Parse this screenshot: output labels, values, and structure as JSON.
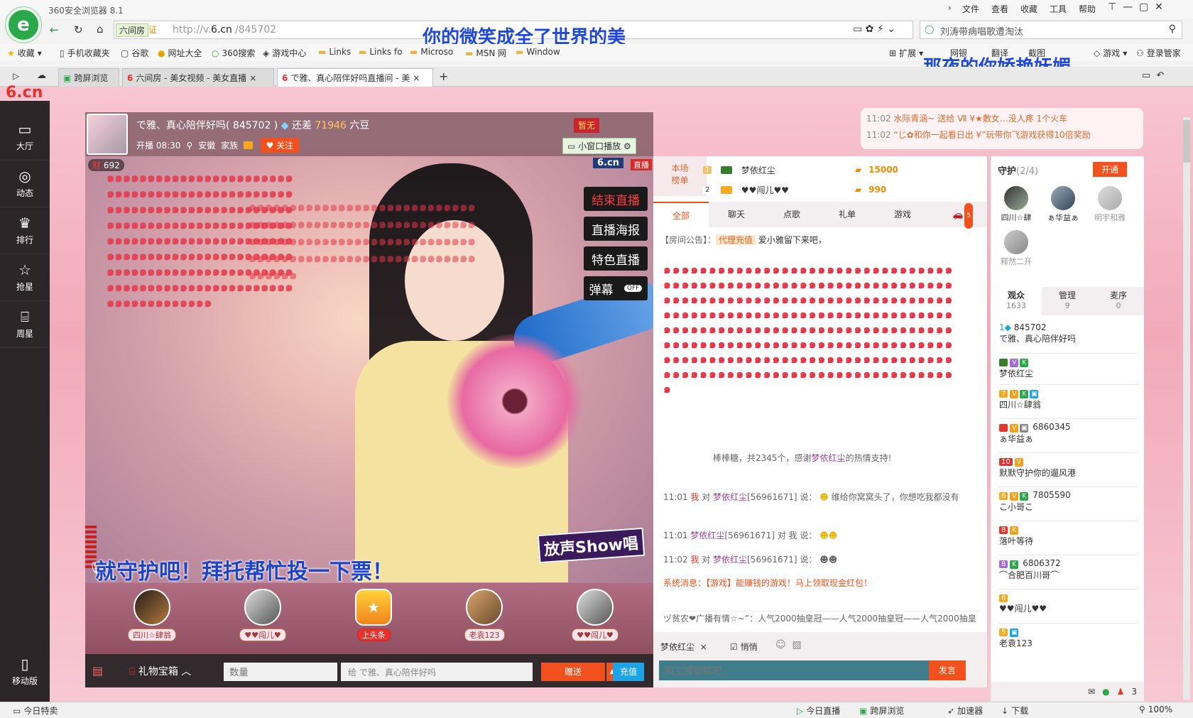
{
  "browser": {
    "app_title": "360安全浏览器 8.1",
    "menu": [
      "文件",
      "查看",
      "收藏",
      "工具",
      "帮助"
    ],
    "address_tag": "六间房",
    "address_cert": "证",
    "url_prefix": "http://v.",
    "url_host": "6.cn",
    "url_path": "/845702",
    "search_text": "刘涛带病唱歌遭淘汰",
    "overlay_top": "你的微笑成全了世界的美",
    "overlay_right": "那夜的你娇艳妩媚",
    "bookmarks": [
      "收藏",
      "手机收藏夹",
      "谷歌",
      "网址大全",
      "360搜索",
      "游戏中心",
      "Links",
      "Links fo",
      "Microso",
      "MSN 网",
      "Window"
    ],
    "tools_right": [
      "扩展",
      "网银",
      "翻译",
      "截图",
      "游戏",
      "登录管家"
    ],
    "tabs": [
      {
        "label": "跨屏浏览"
      },
      {
        "label": "六间房 - 美女视频 - 美女直播"
      },
      {
        "label": "で雅、真心陪伴好吗直播间 - 美"
      }
    ],
    "statusbar": [
      "今日特卖",
      "今日直播",
      "跨屏浏览",
      "加速器",
      "下载",
      "100%"
    ]
  },
  "sidenav": [
    {
      "label": "大厅",
      "icon": "tv-icon"
    },
    {
      "label": "动态",
      "icon": "compass-icon"
    },
    {
      "label": "排行",
      "icon": "crown-icon"
    },
    {
      "label": "抢星",
      "icon": "star-icon"
    },
    {
      "label": "周星",
      "icon": "gift-icon"
    }
  ],
  "mobile_label": "移动版",
  "host": {
    "title": "で雅、真心陪伴好吗",
    "room_id": "( 845702 )",
    "need_text": "还差",
    "need_num": "71946",
    "need_unit": "六豆",
    "start": "开播 08:30",
    "location": "安徽",
    "family": "家族",
    "follow": "关注",
    "mini": "小窗口播放",
    "cash": "692",
    "logo": "6.cn",
    "live": "直播",
    "crown_tag": "暂无"
  },
  "video_buttons": [
    "结束直播",
    "直播海报",
    "特色直播"
  ],
  "danmaku": "弹幕",
  "danmaku_state": "OFF",
  "video_caption": "就守护吧！拜托帮忙投一下票！",
  "brand_show": "放声Show唱",
  "guards_bottom": [
    {
      "name": "四川☆肆翁"
    },
    {
      "name": "♥♥闯儿♥"
    },
    {
      "name": "上头条"
    },
    {
      "name": "老袁123"
    },
    {
      "name": "♥♥闯儿♥"
    }
  ],
  "giftbar": {
    "gift_box": "礼物宝箱",
    "qty_placeholder": "数量",
    "to_label": "给",
    "to_name": "で雅、真心陪伴好吗",
    "send": "赠送",
    "recharge": "充值"
  },
  "rank": {
    "title": "本场",
    "title2": "榜单",
    "rows": [
      {
        "rank": "1",
        "name": "梦依红尘",
        "value": "15000"
      },
      {
        "rank": "2",
        "name": "♥♥闯儿♥♥",
        "value": "990"
      }
    ]
  },
  "chat_tabs": [
    "全部",
    "聊天",
    "点歌",
    "礼单",
    "游戏"
  ],
  "chat_tab_badge": "5",
  "notice": {
    "label": "【房间公告】：",
    "tag": "代理充值",
    "text": "爱小雅留下来吧，"
  },
  "gift_msg": {
    "text": "棒棒糖，共2345个，感谢",
    "name": "梦依红尘",
    "tail": "的热情支持!"
  },
  "chat": [
    {
      "time": "11:01",
      "me": "我",
      "to": "对",
      "user": "梦依红尘",
      "uid": "[56961671]",
      "say": "说：",
      "msg": "维给你窝窝头了，你想吃我都没有"
    },
    {
      "time": "11:01",
      "me": "",
      "to": "",
      "user": "梦依红尘",
      "uid": "[56961671]",
      "say": "对 我 说：",
      "msg": ""
    },
    {
      "time": "11:02",
      "me": "我",
      "to": "对",
      "user": "梦依红尘",
      "uid": "[56961671]",
      "say": "说：",
      "msg": ""
    }
  ],
  "sys_msg": "系统消息：【游戏】能赚钱的游戏！马上领取现金红包！",
  "broadcast": "ヅ贫农❤广播有情☆~”：人气2000抽皇冠——人气2000抽皇冠——人气2000抽皇",
  "chat_input": {
    "target": "梦依红尘",
    "quiet": "悄悄",
    "placeholder": "和主播聊聊吧...",
    "send": "发言"
  },
  "notif": [
    {
      "time": "11:02",
      "text": "水际青涵~ 送给 Ⅶ ¥★敷女…没人疼 1个火车"
    },
    {
      "time": "11:02",
      "text": "“じ✿和你一起看日出 ¥”玩带你飞游戏获得10倍奖励"
    }
  ],
  "guard_panel": {
    "title": "守护",
    "count": "(2/4)",
    "open": "开通",
    "members": [
      "四川☆肆",
      "ぁ华益ぁ",
      "明宇和雅",
      "释然二开"
    ]
  },
  "audience_tabs": [
    {
      "label": "观众",
      "num": "1633"
    },
    {
      "label": "管理",
      "num": "9"
    },
    {
      "label": "麦序",
      "num": "0"
    }
  ],
  "audience": [
    {
      "line1": "845702",
      "line2": "で雅、真心陪伴好吗"
    },
    {
      "line1": "",
      "line2": "梦依红尘"
    },
    {
      "line1": "",
      "line2": "四川☆肆翁"
    },
    {
      "line1": "6860345",
      "line2": "ぁ华益ぁ"
    },
    {
      "line1": "",
      "line2": "默默守护你的遛风港"
    },
    {
      "line1": "7805590",
      "line2": "こ小哥こ"
    },
    {
      "line1": "",
      "line2": "落叶等待"
    },
    {
      "line1": "6806372",
      "line2": "⌒合肥百川哥⌒"
    },
    {
      "line1": "",
      "line2": "♥♥闯儿♥♥"
    },
    {
      "line1": "",
      "line2": "老袁123"
    }
  ],
  "panel_footer_num": "3"
}
